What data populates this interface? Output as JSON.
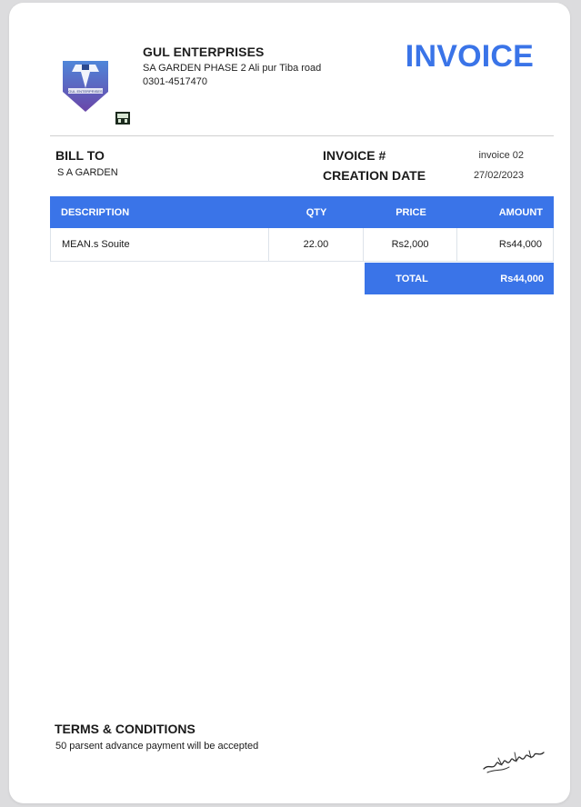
{
  "company": {
    "name": "GUL ENTERPRISES",
    "address": "SA GARDEN PHASE 2 Ali pur Tiba road",
    "phone": "0301-4517470",
    "logo_text": "GUL ENTERPRISES"
  },
  "document": {
    "title": "INVOICE"
  },
  "bill_to": {
    "label": "BILL TO",
    "name": "S A GARDEN"
  },
  "invoice": {
    "number_label": "INVOICE #",
    "number": "invoice 02",
    "date_label": "CREATION DATE",
    "date": "27/02/2023"
  },
  "table": {
    "headers": {
      "description": "DESCRIPTION",
      "qty": "QTY",
      "price": "PRICE",
      "amount": "AMOUNT"
    },
    "rows": [
      {
        "description": "MEAN.s Souite",
        "qty": "22.00",
        "price": "Rs2,000",
        "amount": "Rs44,000"
      }
    ],
    "total_label": "TOTAL",
    "total_value": "Rs44,000"
  },
  "terms": {
    "title": "TERMS & CONDITIONS",
    "text": "50 parsent advance payment will be accepted"
  },
  "colors": {
    "accent": "#3a74e8",
    "logo_blue": "#4a6fc4",
    "logo_purple": "#6b4aa8"
  },
  "icons": {
    "logo": "company-logo-icon",
    "small_mark": "stamp-mark-icon",
    "signature": "signature-icon"
  }
}
